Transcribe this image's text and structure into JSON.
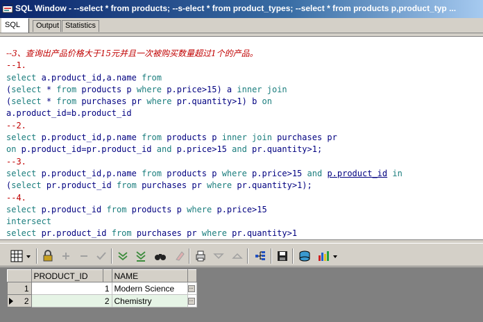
{
  "window": {
    "title": "SQL Window - --select * from products; --s-elect * from product_types; --select * from products p,product_typ ..."
  },
  "tabs": [
    {
      "label": "SQL"
    },
    {
      "label": "Output"
    },
    {
      "label": "Statistics"
    }
  ],
  "editor": {
    "lines": [
      [
        {
          "t": "--3、查询出产品价格大于15元并且一次被购买数量超过1个的产品。",
          "c": "cm zh"
        }
      ],
      [
        {
          "t": "--1.",
          "c": "cm"
        }
      ],
      [
        {
          "t": "select",
          "c": "kw"
        },
        {
          "t": " a.product_id,a.name ",
          "c": "tx"
        },
        {
          "t": "from",
          "c": "kw"
        }
      ],
      [
        {
          "t": "(",
          "c": "tx"
        },
        {
          "t": "select",
          "c": "kw"
        },
        {
          "t": " * ",
          "c": "tx"
        },
        {
          "t": "from",
          "c": "kw"
        },
        {
          "t": " products p ",
          "c": "tx"
        },
        {
          "t": "where",
          "c": "kw"
        },
        {
          "t": " p.price>15) a ",
          "c": "tx"
        },
        {
          "t": "inner join",
          "c": "kw"
        }
      ],
      [
        {
          "t": "(",
          "c": "tx"
        },
        {
          "t": "select",
          "c": "kw"
        },
        {
          "t": " * ",
          "c": "tx"
        },
        {
          "t": "from",
          "c": "kw"
        },
        {
          "t": " purchases pr ",
          "c": "tx"
        },
        {
          "t": "where",
          "c": "kw"
        },
        {
          "t": " pr.quantity>1) b ",
          "c": "tx"
        },
        {
          "t": "on",
          "c": "kw"
        }
      ],
      [
        {
          "t": "a.product_id=b.product_id",
          "c": "tx"
        }
      ],
      [
        {
          "t": "--2.",
          "c": "cm"
        }
      ],
      [
        {
          "t": "select",
          "c": "kw"
        },
        {
          "t": " p.product_id,p.name ",
          "c": "tx"
        },
        {
          "t": "from",
          "c": "kw"
        },
        {
          "t": " products p ",
          "c": "tx"
        },
        {
          "t": "inner join",
          "c": "kw"
        },
        {
          "t": " purchases pr",
          "c": "tx"
        }
      ],
      [
        {
          "t": "on",
          "c": "kw"
        },
        {
          "t": " p.product_id=pr.product_id ",
          "c": "tx"
        },
        {
          "t": "and",
          "c": "kw"
        },
        {
          "t": " p.price>15 ",
          "c": "tx"
        },
        {
          "t": "and",
          "c": "kw"
        },
        {
          "t": " pr.quantity>1;",
          "c": "tx"
        }
      ],
      [
        {
          "t": "--3.",
          "c": "cm"
        }
      ],
      [
        {
          "t": "select",
          "c": "kw"
        },
        {
          "t": " p.product_id,p.name ",
          "c": "tx"
        },
        {
          "t": "from",
          "c": "kw"
        },
        {
          "t": " products p ",
          "c": "tx"
        },
        {
          "t": "where",
          "c": "kw"
        },
        {
          "t": " p.price>15 ",
          "c": "tx"
        },
        {
          "t": "and",
          "c": "kw"
        },
        {
          "t": " ",
          "c": "tx"
        },
        {
          "t": "p.product_id",
          "c": "ul"
        },
        {
          "t": " ",
          "c": "tx"
        },
        {
          "t": "in",
          "c": "kw"
        }
      ],
      [
        {
          "t": "(",
          "c": "tx"
        },
        {
          "t": "select",
          "c": "kw"
        },
        {
          "t": " pr.product_id ",
          "c": "tx"
        },
        {
          "t": "from",
          "c": "kw"
        },
        {
          "t": " purchases pr ",
          "c": "tx"
        },
        {
          "t": "where",
          "c": "kw"
        },
        {
          "t": " pr.quantity>1);",
          "c": "tx"
        }
      ],
      [
        {
          "t": "--4.",
          "c": "cm"
        }
      ],
      [
        {
          "t": "select",
          "c": "kw"
        },
        {
          "t": " p.product_id ",
          "c": "tx"
        },
        {
          "t": "from",
          "c": "kw"
        },
        {
          "t": " products p ",
          "c": "tx"
        },
        {
          "t": "where",
          "c": "kw"
        },
        {
          "t": " p.price>15",
          "c": "tx"
        }
      ],
      [
        {
          "t": "intersect",
          "c": "kw"
        }
      ],
      [
        {
          "t": "select",
          "c": "kw"
        },
        {
          "t": " pr.product_id ",
          "c": "tx"
        },
        {
          "t": "from",
          "c": "kw"
        },
        {
          "t": " purchases pr ",
          "c": "tx"
        },
        {
          "t": "where",
          "c": "kw"
        },
        {
          "t": " pr.quantity>1",
          "c": "tx"
        }
      ]
    ]
  },
  "toolbar": {
    "icons": [
      "grid-icon",
      "chevron-down-icon",
      "lock-icon",
      "add-icon",
      "remove-icon",
      "check-icon",
      "fetch-next-icon",
      "fetch-last-icon",
      "find-icon",
      "clear-icon",
      "print-icon",
      "arrow-down-icon",
      "arrow-up-icon",
      "tree-icon",
      "save-icon",
      "export-icon",
      "chart-icon",
      "chevron-down-icon"
    ]
  },
  "results": {
    "columns": [
      "PRODUCT_ID",
      "NAME"
    ],
    "rows": [
      {
        "rownum": "1",
        "product_id": "1",
        "name": "Modern Science"
      },
      {
        "rownum": "2",
        "product_id": "2",
        "name": "Chemistry"
      }
    ]
  }
}
